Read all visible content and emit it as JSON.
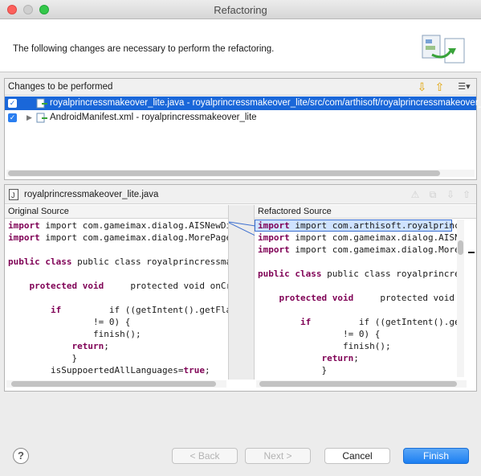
{
  "window": {
    "title": "Refactoring"
  },
  "header": {
    "message": "The following changes are necessary to perform the refactoring."
  },
  "changes": {
    "title": "Changes to be performed",
    "items": [
      {
        "label": "royalprincressmakeover_lite.java - royalprincressmakeover_lite/src/com/arthisoft/royalprincressmakeover_lite",
        "checked": true,
        "selected": true
      },
      {
        "label": "AndroidManifest.xml - royalprincressmakeover_lite",
        "checked": true,
        "selected": false
      }
    ]
  },
  "compare": {
    "file_name": "royalprincressmakeover_lite.java",
    "original_header": "Original Source",
    "refactored_header": "Refactored Source",
    "original_lines": [
      "import com.gameimax.dialog.AISNewDialog;",
      "import com.gameimax.dialog.MorePagerAdapter;",
      "",
      "public class royalprincressmakeover_lite",
      "",
      "    protected void onCreate(Bundle savedInstanceState) {",
      "",
      "        if ((getIntent().getFlags() & Intent.",
      "                != 0) {",
      "                finish();",
      "            return;",
      "            }",
      "        isSuppoertedAllLanguages=true;"
    ],
    "refactored_lines": [
      "import com.arthisoft.royalprincress",
      "import com.gameimax.dialog.AISNewDialog;",
      "import com.gameimax.dialog.MorePagerAdapter;",
      "",
      "public class royalprincressmakeover_lite",
      "",
      "    protected void onCreate(Bundle savedInstanceState) {",
      "",
      "        if ((getIntent().getFlags() & Intent.",
      "                != 0) {",
      "                finish();",
      "            return;",
      "            }"
    ]
  },
  "buttons": {
    "help": "?",
    "back": "< Back",
    "next": "Next >",
    "cancel": "Cancel",
    "finish": "Finish"
  }
}
